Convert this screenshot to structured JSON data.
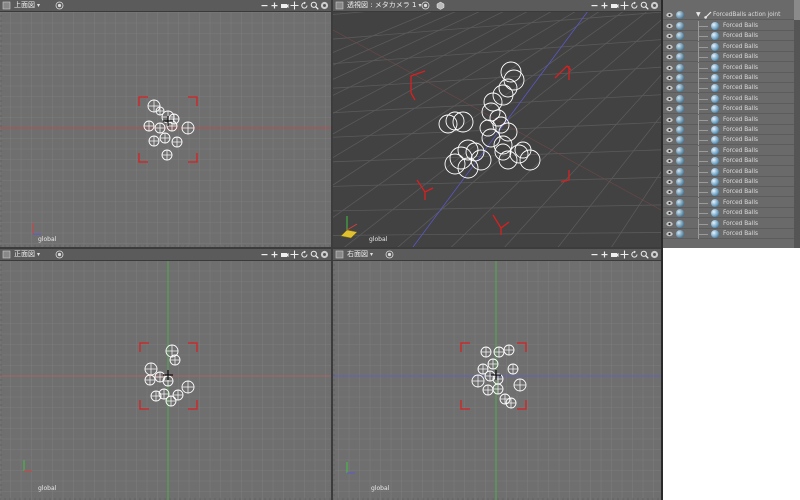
{
  "viewports": {
    "top": {
      "title": "上面図",
      "coord_label": "global"
    },
    "perspective": {
      "title": "透視図 : メタカメラ 1",
      "coord_label": "global"
    },
    "front": {
      "title": "正面図",
      "coord_label": "global"
    },
    "right": {
      "title": "右面図",
      "coord_label": "global"
    }
  },
  "header_tools": [
    "zoom-out-icon",
    "zoom-in-icon",
    "camera-icon",
    "pan-icon",
    "rotate-icon",
    "magnify-icon",
    "lock-icon"
  ],
  "outliner": {
    "parent_label": "ForcedBalls action joint",
    "child_label": "Forced Balls",
    "child_count": 21
  },
  "colors": {
    "viewport_bg": "#6f6f6f",
    "perspective_bg": "#424242",
    "grid_line": "#7c7c7c",
    "axis_red": "#d04040",
    "axis_green": "#40c040",
    "axis_blue": "#5a5ad0",
    "bounding_bracket": "#d82020",
    "ball_outline": "#ffffff"
  }
}
